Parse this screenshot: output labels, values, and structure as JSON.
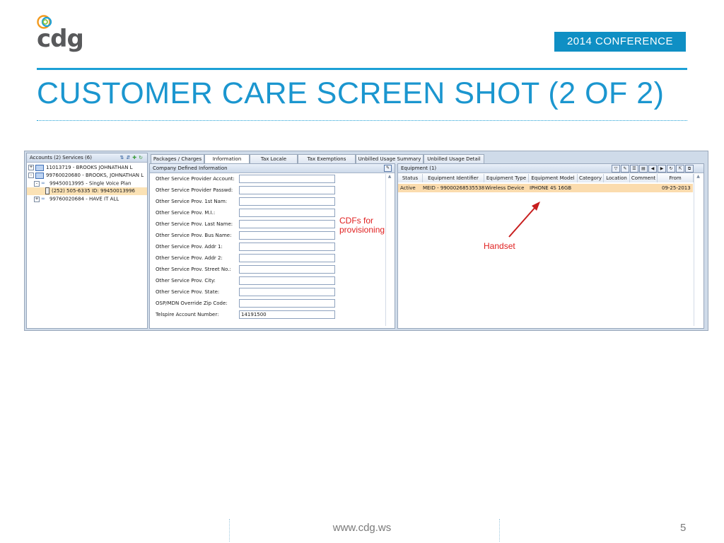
{
  "slide": {
    "logo_text": "cdg",
    "badge": "2014 CONFERENCE",
    "title": "CUSTOMER CARE SCREEN SHOT (2 OF 2)",
    "footer_url": "www.cdg.ws",
    "page_number": "5"
  },
  "left_panel": {
    "header": "Accounts (2) Services (6)",
    "tree": [
      {
        "expander": "+",
        "icon": "book-icon",
        "label": "11013719 - BROOKS JOHNATHAN L"
      },
      {
        "expander": "-",
        "icon": "book-icon",
        "label": "99760020680 - BROOKS, JOHNATHAN L"
      },
      {
        "expander": "-",
        "icon": "link-icon",
        "label": "99450013995 - Single Voice Plan"
      },
      {
        "expander": "",
        "icon": "phone-icon",
        "label": "(252) 505-6335 ID: 99450013996"
      },
      {
        "expander": "+",
        "icon": "link-icon",
        "label": "99760020684 - HAVE IT ALL"
      }
    ]
  },
  "tabs": [
    {
      "label": "Packages / Charges"
    },
    {
      "label": "Information"
    },
    {
      "label": "Tax Locale"
    },
    {
      "label": "Tax Exemptions"
    },
    {
      "label": "Unbilled Usage Summary"
    },
    {
      "label": "Unbilled Usage Detail"
    }
  ],
  "cdf_panel": {
    "header": "Company Defined Information",
    "fields": [
      {
        "label": "Other Service Provider Account:",
        "value": ""
      },
      {
        "label": "Other Service Provider Passwd:",
        "value": ""
      },
      {
        "label": "Other Service Prov. 1st Nam:",
        "value": ""
      },
      {
        "label": "Other Service Prov. M.I.:",
        "value": ""
      },
      {
        "label": "Other Service Prov. Last Name:",
        "value": ""
      },
      {
        "label": "Other Service Prov. Bus Name:",
        "value": ""
      },
      {
        "label": "Other Service Prov. Addr 1:",
        "value": ""
      },
      {
        "label": "Other Service Prov. Addr 2:",
        "value": ""
      },
      {
        "label": "Other Service Prov. Street No.:",
        "value": ""
      },
      {
        "label": "Other Service Prov. City:",
        "value": ""
      },
      {
        "label": "Other Service Prov. State:",
        "value": ""
      },
      {
        "label": "OSP/MDN Override Zip Code:",
        "value": ""
      },
      {
        "label": "Telspire Account Number:",
        "value": "14191500"
      }
    ]
  },
  "equipment_panel": {
    "header": "Equipment (1)",
    "columns": [
      "Status",
      "Equipment Identifier",
      "Equipment Type",
      "Equipment Model",
      "Category",
      "Location",
      "Comment",
      "From"
    ],
    "rows": [
      [
        "Active",
        "MEID - 99000268535538",
        "Wireless Device",
        "IPHONE 4S 16GB",
        "",
        "",
        "",
        "09-25-2013"
      ]
    ]
  },
  "annotations": {
    "cdf_note_line1": "CDFs for",
    "cdf_note_line2": "provisioning",
    "handset_note": "Handset"
  },
  "colors": {
    "brand_blue": "#1b96cf",
    "badge_blue": "#0f8fc4",
    "annotation_red": "#e02020",
    "selection": "#fbdcae"
  }
}
